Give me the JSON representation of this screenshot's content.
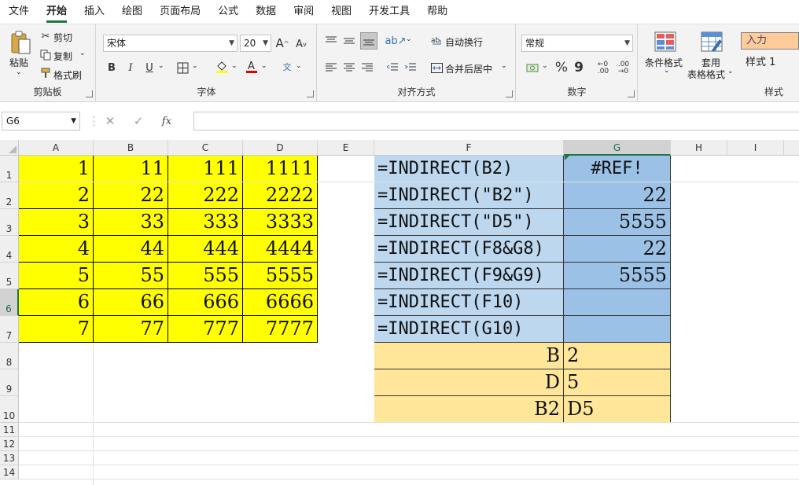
{
  "menu": {
    "tabs": [
      "文件",
      "开始",
      "插入",
      "绘图",
      "页面布局",
      "公式",
      "数据",
      "审阅",
      "视图",
      "开发工具",
      "帮助"
    ],
    "active_index": 1
  },
  "ribbon": {
    "clipboard": {
      "paste": "粘贴",
      "cut": "剪切",
      "copy": "复制",
      "format_painter": "格式刷",
      "label": "剪贴板"
    },
    "font": {
      "name": "宋体",
      "size": "20",
      "label": "字体",
      "bold": "B",
      "italic": "I",
      "underline": "U",
      "grow": "A",
      "shrink": "A",
      "phonetic": "文"
    },
    "alignment": {
      "wrap": "自动换行",
      "merge": "合并后居中",
      "label": "对齐方式"
    },
    "number": {
      "format": "常规",
      "percent": "%",
      "comma": "9",
      "label": "数字"
    },
    "styles": {
      "conditional": "条件格式",
      "table_format_1": "套用",
      "table_format_2": "表格格式",
      "style_input": "入力",
      "style_1": "样式 1",
      "label": "样式"
    }
  },
  "formula_bar": {
    "name_box": "G6",
    "cancel": "✕",
    "enter": "✓",
    "fx": "fx",
    "value": ""
  },
  "columns": [
    "A",
    "B",
    "C",
    "D",
    "E",
    "F",
    "G",
    "H",
    "I"
  ],
  "selected_col": "G",
  "rows": [
    "1",
    "2",
    "3",
    "4",
    "5",
    "6",
    "7",
    "8",
    "9",
    "10",
    "11",
    "12",
    "13",
    "14"
  ],
  "selected_row": "6",
  "cells": {
    "A": [
      "1",
      "2",
      "3",
      "4",
      "5",
      "6",
      "7"
    ],
    "B": [
      "11",
      "22",
      "33",
      "44",
      "55",
      "66",
      "77"
    ],
    "C": [
      "111",
      "222",
      "333",
      "444",
      "555",
      "666",
      "777"
    ],
    "D": [
      "1111",
      "2222",
      "3333",
      "4444",
      "5555",
      "6666",
      "7777"
    ],
    "F": [
      "=INDIRECT(B2)",
      "=INDIRECT(\"B2\")",
      "=INDIRECT(\"D5\")",
      "=INDIRECT(F8&G8)",
      "=INDIRECT(F9&G9)",
      "=INDIRECT(F10)",
      "=INDIRECT(G10)",
      "B",
      "D",
      "B2"
    ],
    "G": [
      "#REF!",
      "22",
      "5555",
      "22",
      "5555",
      "",
      "",
      "2",
      "5",
      "D5"
    ]
  },
  "colors": {
    "accent": "#217346",
    "yellow": "#ffff00",
    "blue": "#9bc2e6",
    "blue_light": "#bdd7ee",
    "orange": "#ffe699"
  }
}
